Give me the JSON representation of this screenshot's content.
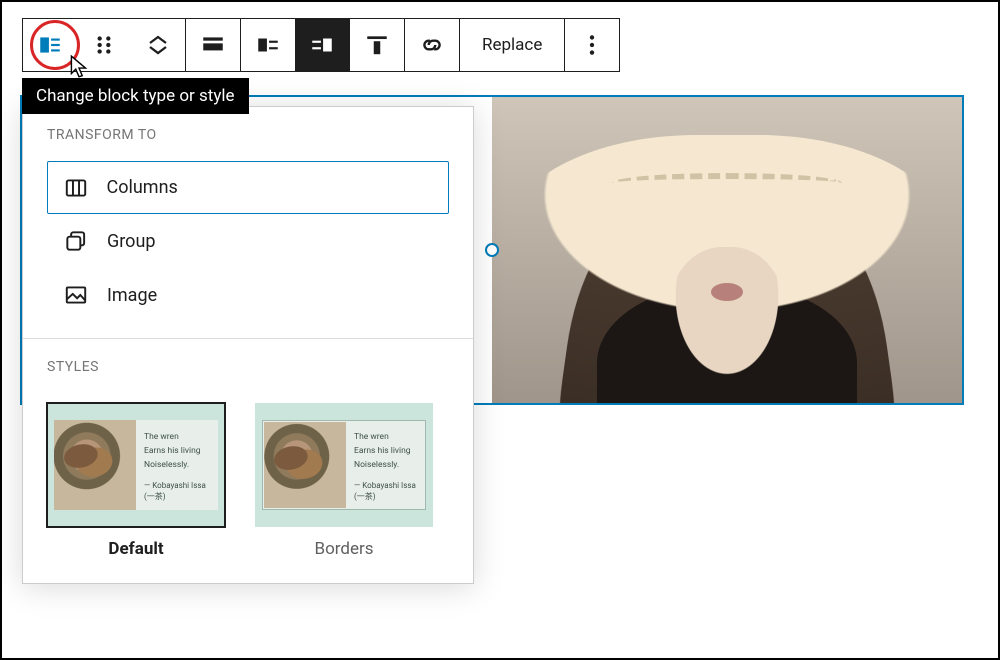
{
  "accent": "#007cba",
  "toolbar": {
    "replace_label": "Replace"
  },
  "tooltip": "Change block type or style",
  "flyout": {
    "transform_heading": "Transform to",
    "items": [
      {
        "name": "columns",
        "label": "Columns"
      },
      {
        "name": "group",
        "label": "Group"
      },
      {
        "name": "image",
        "label": "Image"
      }
    ],
    "styles_heading": "Styles",
    "styles": [
      {
        "name": "default",
        "label": "Default",
        "selected": true
      },
      {
        "name": "borders",
        "label": "Borders",
        "selected": false
      }
    ],
    "sample_quote": {
      "line1": "The wren",
      "line2": "Earns his living",
      "line3": "Noiselessly.",
      "attribution": "— Kobayashi Issa (一茶)"
    }
  }
}
